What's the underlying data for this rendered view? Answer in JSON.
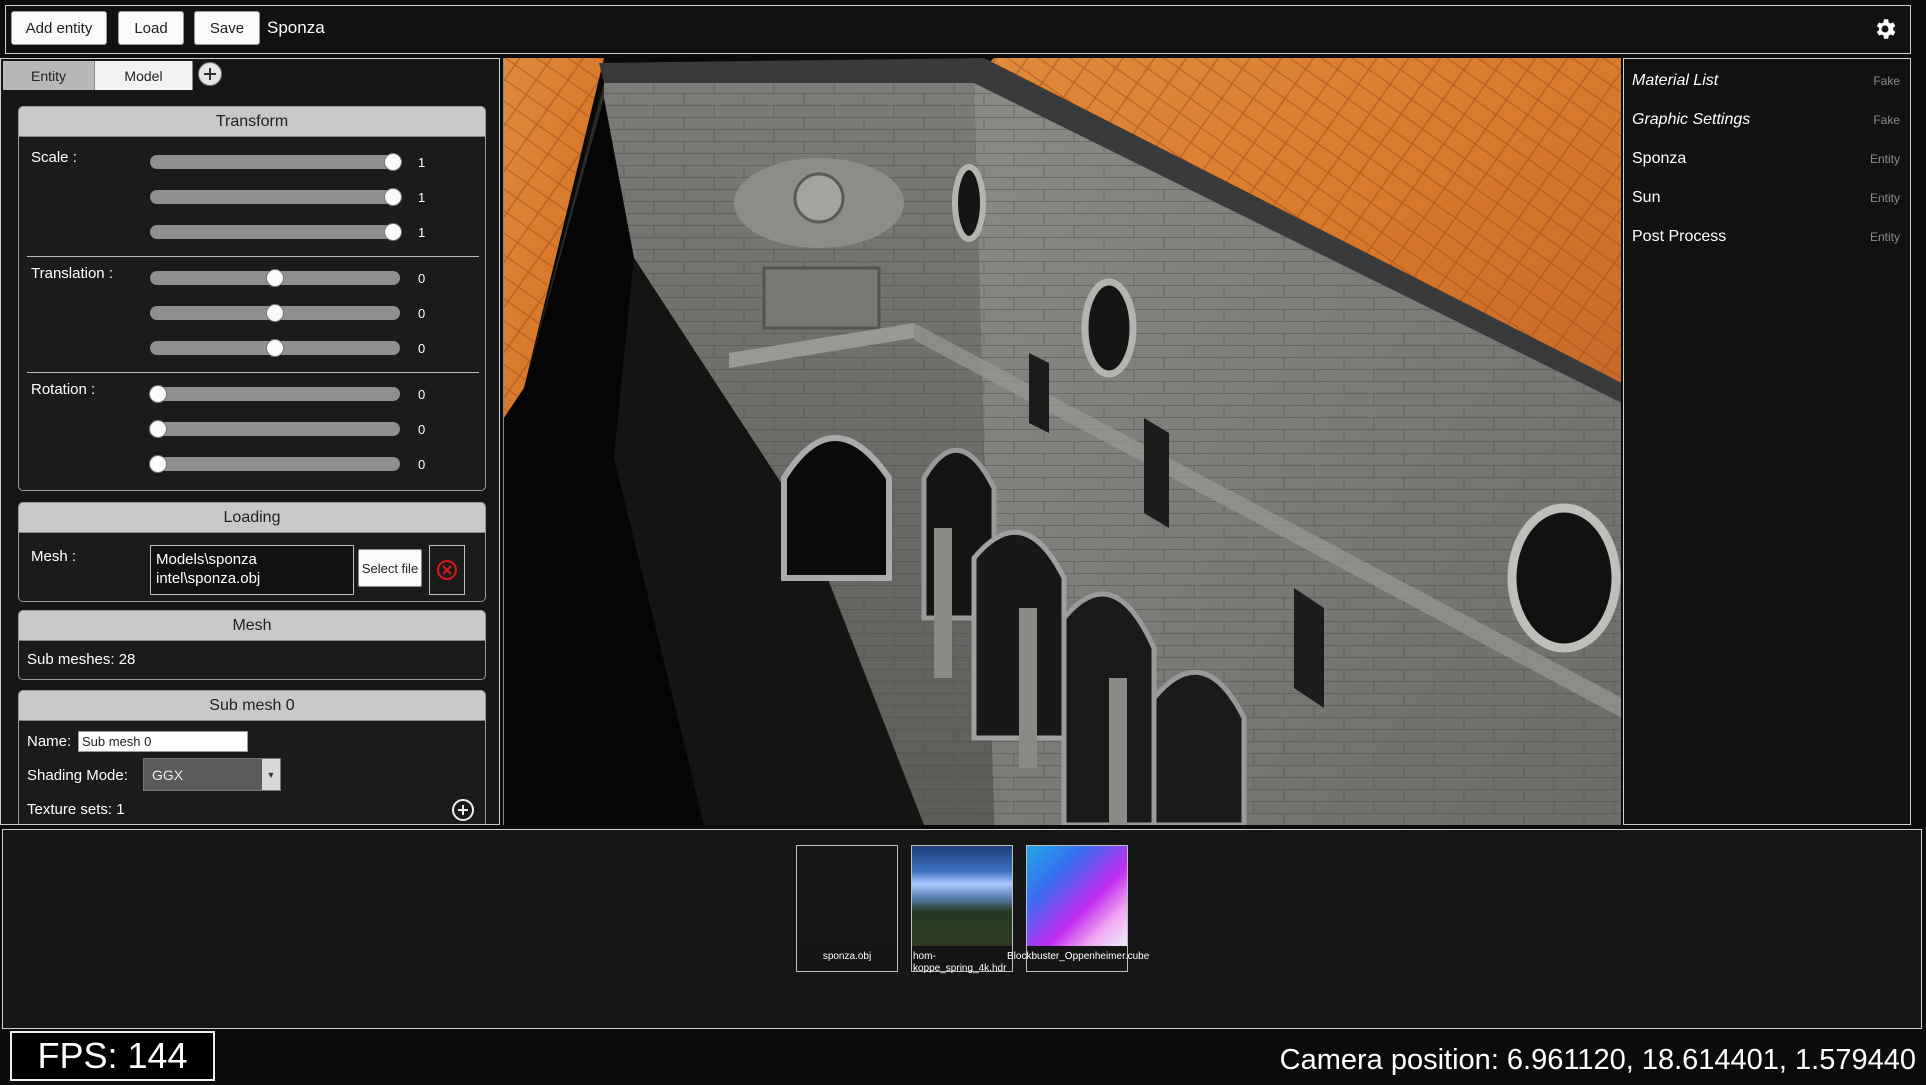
{
  "topbar": {
    "add_entity": "Add entity",
    "load": "Load",
    "save": "Save",
    "scene_name": "Sponza",
    "settings_icon": "gear-icon"
  },
  "left_panel": {
    "tabs": [
      {
        "label": "Entity"
      },
      {
        "label": "Model"
      }
    ],
    "add_tab_icon": "plus-circle-icon",
    "transform": {
      "title": "Transform",
      "scale_label": "Scale :",
      "translation_label": "Translation :",
      "rotation_label": "Rotation :",
      "scale": [
        {
          "value": "1",
          "fraction": 0.97
        },
        {
          "value": "1",
          "fraction": 0.97
        },
        {
          "value": "1",
          "fraction": 0.97
        }
      ],
      "translation": [
        {
          "value": "0",
          "fraction": 0.5
        },
        {
          "value": "0",
          "fraction": 0.5
        },
        {
          "value": "0",
          "fraction": 0.5
        }
      ],
      "rotation": [
        {
          "value": "0",
          "fraction": 0.03
        },
        {
          "value": "0",
          "fraction": 0.03
        },
        {
          "value": "0",
          "fraction": 0.03
        }
      ]
    },
    "loading": {
      "title": "Loading",
      "mesh_label": "Mesh :",
      "mesh_path_line1": "Models\\sponza",
      "mesh_path_line2": "intel\\sponza.obj",
      "select_file": "Select file",
      "remove_icon": "close-circle-icon"
    },
    "mesh": {
      "title": "Mesh",
      "sub_meshes": "Sub meshes: 28"
    },
    "sub_mesh": {
      "title": "Sub mesh 0",
      "name_label": "Name:",
      "name_value": "Sub mesh 0",
      "shading_label": "Shading Mode:",
      "shading_value": "GGX",
      "texture_sets": "Texture sets: 1",
      "add_texture_icon": "plus-circle-icon"
    }
  },
  "right_panel": {
    "items": [
      {
        "name": "Material List",
        "type": "Fake",
        "italic": true
      },
      {
        "name": "Graphic Settings",
        "type": "Fake",
        "italic": true
      },
      {
        "name": "Sponza",
        "type": "Entity",
        "italic": false
      },
      {
        "name": "Sun",
        "type": "Entity",
        "italic": false
      },
      {
        "name": "Post Process",
        "type": "Entity",
        "italic": false
      }
    ]
  },
  "assets": [
    {
      "label": "sponza.obj"
    },
    {
      "label": "hom-koppe_spring_4k.hdr"
    },
    {
      "label": "Blockbuster_Oppenheimer.cube"
    }
  ],
  "footer": {
    "fps": "FPS: 144",
    "camera_position": "Camera position: 6.961120, 18.614401, 1.579440"
  }
}
